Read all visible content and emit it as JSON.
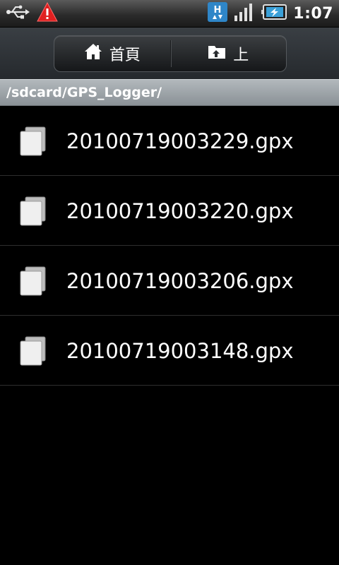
{
  "status_bar": {
    "time": "1:07",
    "icons": [
      "usb-icon",
      "warning-icon",
      "hspa-icon",
      "signal-icon",
      "battery-charging-icon"
    ],
    "network_label": "H"
  },
  "toolbar": {
    "home_label": "首頁",
    "up_label": "上",
    "home_icon": "home-icon",
    "up_icon": "folder-up-icon"
  },
  "path": "/sdcard/GPS_Logger/",
  "files": [
    {
      "name": "20100719003229.gpx",
      "icon": "file-icon"
    },
    {
      "name": "20100719003220.gpx",
      "icon": "file-icon"
    },
    {
      "name": "20100719003206.gpx",
      "icon": "file-icon"
    },
    {
      "name": "20100719003148.gpx",
      "icon": "file-icon"
    }
  ],
  "colors": {
    "background": "#000000",
    "warning": "#e02020",
    "network_badge": "#2f86c8",
    "battery_charge": "#3aa0d8"
  }
}
